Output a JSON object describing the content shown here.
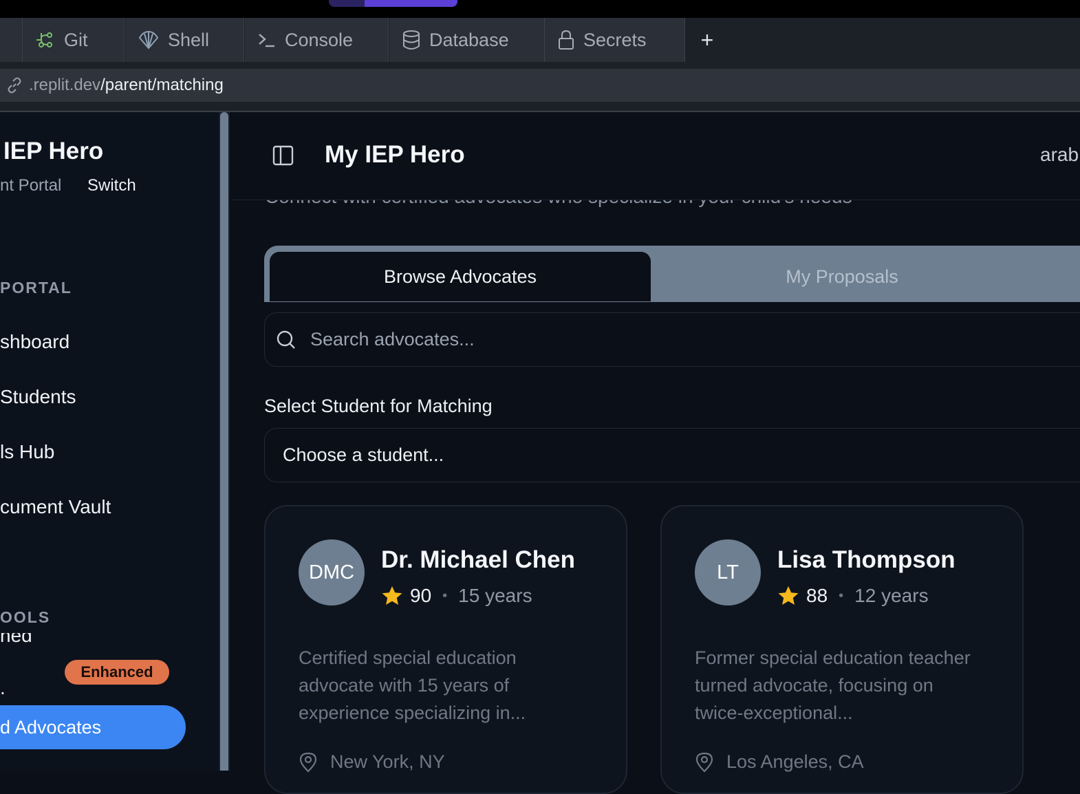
{
  "browser_tabs": [
    {
      "label": "Git",
      "icon": "git-branch-icon"
    },
    {
      "label": "Shell",
      "icon": "shell-icon"
    },
    {
      "label": "Console",
      "icon": "terminal-icon"
    },
    {
      "label": "Database",
      "icon": "database-icon"
    },
    {
      "label": "Secrets",
      "icon": "lock-icon"
    }
  ],
  "new_tab_label": "+",
  "url": {
    "host": ".replit.dev",
    "path": "/parent/matching"
  },
  "sidebar": {
    "brand": "IEP Hero",
    "portal_label": "nt Portal",
    "switch_label": "Switch",
    "section_portal": "PORTAL",
    "nav": [
      "shboard",
      "Students",
      "ls Hub",
      "cument Vault"
    ],
    "section_tools": "OOLS",
    "partial_item_a": "ned",
    "partial_item_b": ".",
    "enhanced_badge": "Enhanced",
    "active_item": "d Advocates"
  },
  "header": {
    "title": "My IEP Hero",
    "user": "arab"
  },
  "subtitle": "Connect with certified advocates who specialize in your child's needs",
  "tabs": {
    "browse": "Browse Advocates",
    "proposals": "My Proposals"
  },
  "search": {
    "placeholder": "Search advocates..."
  },
  "student_select": {
    "label": "Select Student for Matching",
    "value": "Choose a student..."
  },
  "advocates": [
    {
      "initials": "DMC",
      "name": "Dr. Michael Chen",
      "rating": "90",
      "years": "15 years",
      "bio": "Certified special education advocate with 15 years of experience specializing in...",
      "location": "New York, NY"
    },
    {
      "initials": "LT",
      "name": "Lisa Thompson",
      "rating": "88",
      "years": "12 years",
      "bio": "Former special education teacher turned advocate, focusing on twice-exceptional...",
      "location": "Los Angeles, CA"
    }
  ],
  "colors": {
    "accent_blue": "#3c86f3",
    "enhanced": "#e1744b",
    "star": "#f5b81d",
    "tab_strip": "#6e7f92"
  }
}
